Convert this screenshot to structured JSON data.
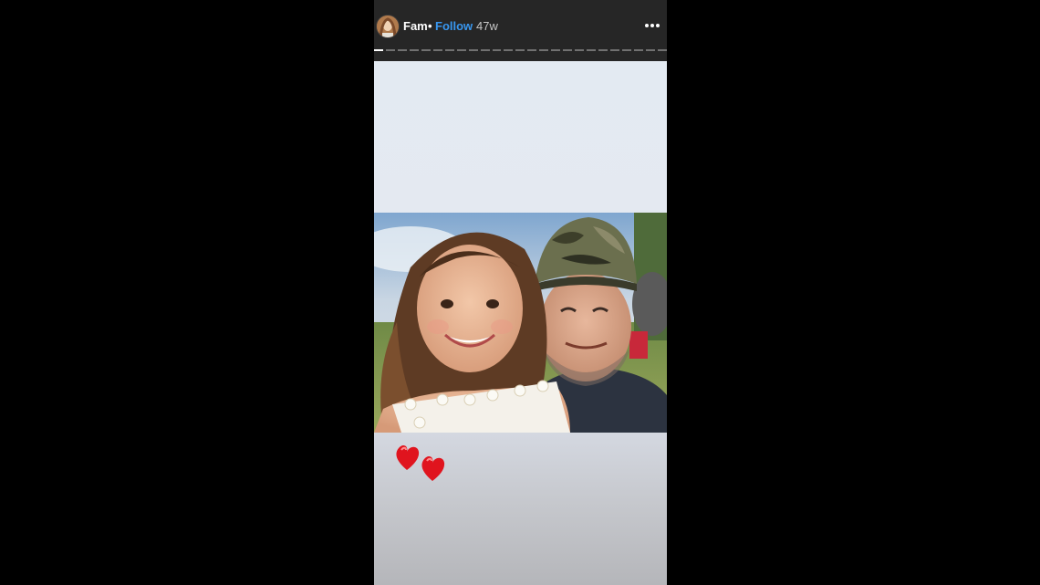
{
  "story": {
    "username": "Fam",
    "separator": "•",
    "follow_label": "Follow",
    "time_ago": "47w",
    "progress_segments": 25,
    "active_segment": 1
  },
  "icons": {
    "more": "more-options-icon",
    "hearts": "red-heart-emoji"
  },
  "colors": {
    "follow": "#3897f0",
    "header_bg": "#262626",
    "page_bg": "#000000",
    "heart": "#e0141e"
  }
}
